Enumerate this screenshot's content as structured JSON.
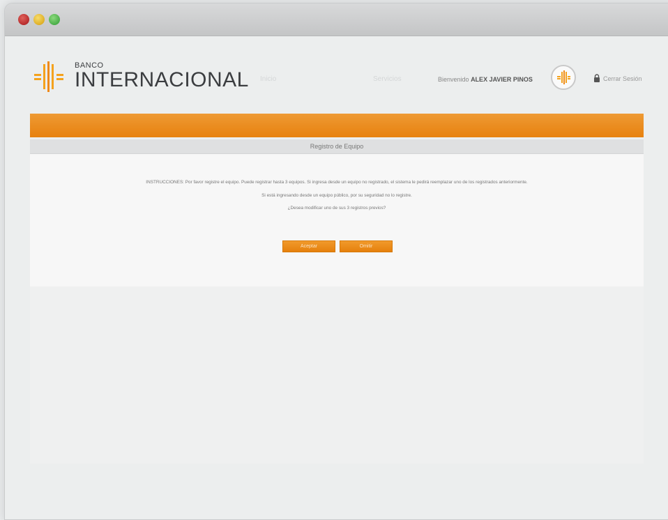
{
  "window": {
    "controls": [
      "close-dot",
      "minimize-dot",
      "maximize-dot"
    ]
  },
  "header": {
    "logo_small": "BANCO",
    "logo_big": "INTERNACIONAL",
    "nav_items": [
      "Inicio",
      "Servicios"
    ],
    "welcome_prefix": "Bienvenido",
    "user_name": "ALEX JAVIER PINOS",
    "logout_label": "Cerrar Sesión",
    "icons": {
      "logo": "bank-logo-icon",
      "avatar": "user-avatar-icon",
      "lock": "lock-icon"
    }
  },
  "page": {
    "subheader_title": "Registro de Equipo",
    "instructions": [
      "INSTRUCCIONES: Por favor registre el equipo. Puede registrar hasta 3 equipos. Si ingresa desde un equipo no registrado, el sistema le pedirá reemplazar uno de los registrados anteriormente.",
      "Si está ingresando desde un equipo público, por su seguridad no lo registre.",
      "¿Desea modificar uno de sus 3 registros previos?"
    ],
    "buttons": {
      "accept": "Aceptar",
      "skip": "Omitir"
    }
  },
  "colors": {
    "brand_orange": "#e8860f",
    "text_dark": "#3b3d40"
  }
}
